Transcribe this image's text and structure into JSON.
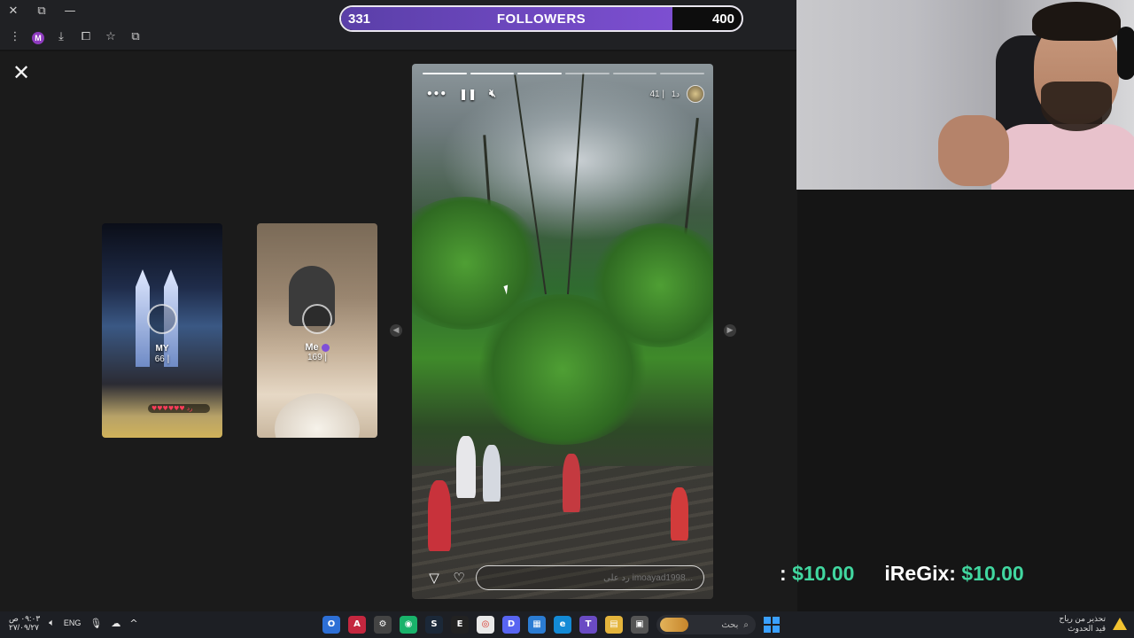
{
  "window": {
    "controls": [
      "close-icon",
      "restore-icon",
      "minimize-icon"
    ]
  },
  "toolbar": {
    "profile_initial": "M",
    "icons": [
      "menu-icon",
      "download-icon",
      "extensions-icon",
      "bookmark-star-icon",
      "tab-search-icon"
    ]
  },
  "followers_goal": {
    "current": "331",
    "label": "FOLLOWERS",
    "goal": "400",
    "progress_fraction": 0.8275,
    "fill_color": "#6a45c0"
  },
  "viewer": {
    "close_icon": "close-icon",
    "prev_icon": "chevron-left-icon",
    "next_icon": "chevron-right-icon",
    "thumbnails": [
      {
        "name": "MY",
        "count": "66 |",
        "reactions": "♥♥♥♥♥♥ رد"
      },
      {
        "name": "Me",
        "count": "169 |"
      }
    ],
    "story": {
      "segments": [
        true,
        true,
        true,
        false,
        false,
        false
      ],
      "controls": [
        "more-icon",
        "pause-icon",
        "mute-icon"
      ],
      "count": "41 |",
      "time": "1د",
      "reply_placeholder": "رد على imoayad1998..."
    }
  },
  "donations": [
    {
      "name": "",
      "amount": "$10.00"
    },
    {
      "name": "iReGix",
      "amount": "$10.00"
    }
  ],
  "taskbar": {
    "clock_time": "٠٩:٠٣ ص",
    "clock_date": "٢٧/٠٩/٢٧",
    "language": "ENG",
    "search_label": "بحث",
    "notification_line1": "تحذير من رياح",
    "notification_line2": "قيد الحدوث"
  },
  "colors": {
    "accent_purple": "#6a45c0",
    "donation_green": "#41d7a0",
    "warning_yellow": "#f2c230"
  }
}
